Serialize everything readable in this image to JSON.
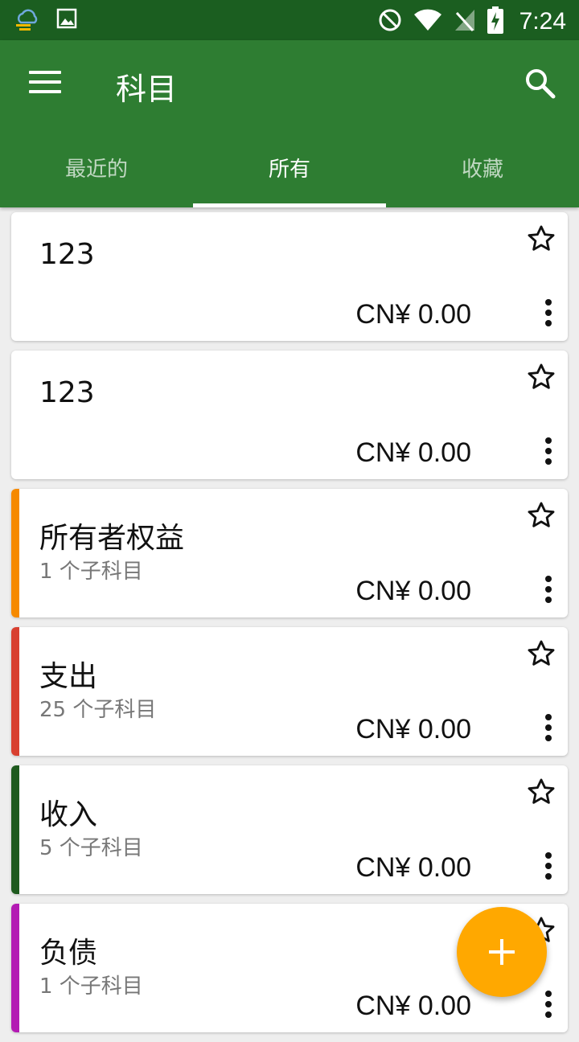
{
  "status_bar": {
    "time": "7:24",
    "left_icons": [
      "weather-icon",
      "image-icon"
    ],
    "right_icons": [
      "do-not-disturb-icon",
      "wifi-icon",
      "no-signal-icon",
      "battery-charging-icon"
    ]
  },
  "app_bar": {
    "title": "科目",
    "menu_icon": "menu-icon",
    "search_icon": "search-icon"
  },
  "tabs": [
    {
      "label": "最近的",
      "active": false
    },
    {
      "label": "所有",
      "active": true
    },
    {
      "label": "收藏",
      "active": false
    }
  ],
  "accounts": [
    {
      "name": "123",
      "subaccounts": "",
      "balance": "CN¥ 0.00",
      "color": ""
    },
    {
      "name": "123",
      "subaccounts": "",
      "balance": "CN¥ 0.00",
      "color": ""
    },
    {
      "name": "所有者权益",
      "subaccounts": "1 个子科目",
      "balance": "CN¥ 0.00",
      "color": "#f68a00"
    },
    {
      "name": "支出",
      "subaccounts": "25 个子科目",
      "balance": "CN¥ 0.00",
      "color": "#d84030"
    },
    {
      "name": "收入",
      "subaccounts": "5 个子科目",
      "balance": "CN¥ 0.00",
      "color": "#1e5a1e"
    },
    {
      "name": "负债",
      "subaccounts": "1 个子科目",
      "balance": "CN¥ 0.00",
      "color": "#b31ab3"
    }
  ],
  "fab": {
    "icon": "plus-icon",
    "color": "#ffa800"
  },
  "colors": {
    "primary": "#2e7d32",
    "primary_dark": "#1b5e20",
    "accent": "#ffa800"
  }
}
